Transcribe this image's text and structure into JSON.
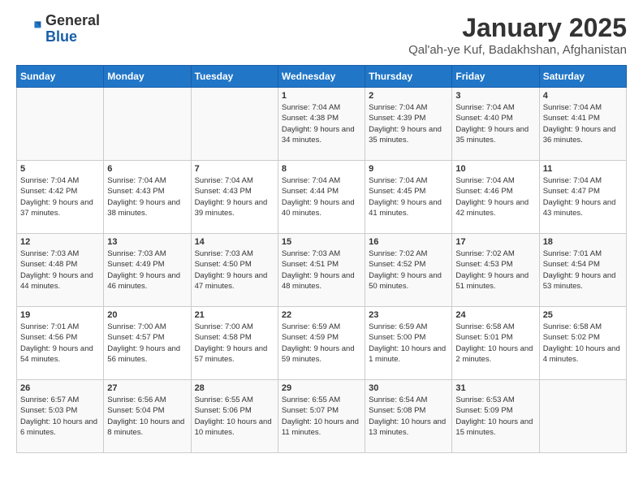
{
  "logo": {
    "general": "General",
    "blue": "Blue"
  },
  "title": "January 2025",
  "subtitle": "Qal'ah-ye Kuf, Badakhshan, Afghanistan",
  "weekdays": [
    "Sunday",
    "Monday",
    "Tuesday",
    "Wednesday",
    "Thursday",
    "Friday",
    "Saturday"
  ],
  "weeks": [
    [
      {
        "day": "",
        "info": ""
      },
      {
        "day": "",
        "info": ""
      },
      {
        "day": "",
        "info": ""
      },
      {
        "day": "1",
        "info": "Sunrise: 7:04 AM\nSunset: 4:38 PM\nDaylight: 9 hours and 34 minutes."
      },
      {
        "day": "2",
        "info": "Sunrise: 7:04 AM\nSunset: 4:39 PM\nDaylight: 9 hours and 35 minutes."
      },
      {
        "day": "3",
        "info": "Sunrise: 7:04 AM\nSunset: 4:40 PM\nDaylight: 9 hours and 35 minutes."
      },
      {
        "day": "4",
        "info": "Sunrise: 7:04 AM\nSunset: 4:41 PM\nDaylight: 9 hours and 36 minutes."
      }
    ],
    [
      {
        "day": "5",
        "info": "Sunrise: 7:04 AM\nSunset: 4:42 PM\nDaylight: 9 hours and 37 minutes."
      },
      {
        "day": "6",
        "info": "Sunrise: 7:04 AM\nSunset: 4:43 PM\nDaylight: 9 hours and 38 minutes."
      },
      {
        "day": "7",
        "info": "Sunrise: 7:04 AM\nSunset: 4:43 PM\nDaylight: 9 hours and 39 minutes."
      },
      {
        "day": "8",
        "info": "Sunrise: 7:04 AM\nSunset: 4:44 PM\nDaylight: 9 hours and 40 minutes."
      },
      {
        "day": "9",
        "info": "Sunrise: 7:04 AM\nSunset: 4:45 PM\nDaylight: 9 hours and 41 minutes."
      },
      {
        "day": "10",
        "info": "Sunrise: 7:04 AM\nSunset: 4:46 PM\nDaylight: 9 hours and 42 minutes."
      },
      {
        "day": "11",
        "info": "Sunrise: 7:04 AM\nSunset: 4:47 PM\nDaylight: 9 hours and 43 minutes."
      }
    ],
    [
      {
        "day": "12",
        "info": "Sunrise: 7:03 AM\nSunset: 4:48 PM\nDaylight: 9 hours and 44 minutes."
      },
      {
        "day": "13",
        "info": "Sunrise: 7:03 AM\nSunset: 4:49 PM\nDaylight: 9 hours and 46 minutes."
      },
      {
        "day": "14",
        "info": "Sunrise: 7:03 AM\nSunset: 4:50 PM\nDaylight: 9 hours and 47 minutes."
      },
      {
        "day": "15",
        "info": "Sunrise: 7:03 AM\nSunset: 4:51 PM\nDaylight: 9 hours and 48 minutes."
      },
      {
        "day": "16",
        "info": "Sunrise: 7:02 AM\nSunset: 4:52 PM\nDaylight: 9 hours and 50 minutes."
      },
      {
        "day": "17",
        "info": "Sunrise: 7:02 AM\nSunset: 4:53 PM\nDaylight: 9 hours and 51 minutes."
      },
      {
        "day": "18",
        "info": "Sunrise: 7:01 AM\nSunset: 4:54 PM\nDaylight: 9 hours and 53 minutes."
      }
    ],
    [
      {
        "day": "19",
        "info": "Sunrise: 7:01 AM\nSunset: 4:56 PM\nDaylight: 9 hours and 54 minutes."
      },
      {
        "day": "20",
        "info": "Sunrise: 7:00 AM\nSunset: 4:57 PM\nDaylight: 9 hours and 56 minutes."
      },
      {
        "day": "21",
        "info": "Sunrise: 7:00 AM\nSunset: 4:58 PM\nDaylight: 9 hours and 57 minutes."
      },
      {
        "day": "22",
        "info": "Sunrise: 6:59 AM\nSunset: 4:59 PM\nDaylight: 9 hours and 59 minutes."
      },
      {
        "day": "23",
        "info": "Sunrise: 6:59 AM\nSunset: 5:00 PM\nDaylight: 10 hours and 1 minute."
      },
      {
        "day": "24",
        "info": "Sunrise: 6:58 AM\nSunset: 5:01 PM\nDaylight: 10 hours and 2 minutes."
      },
      {
        "day": "25",
        "info": "Sunrise: 6:58 AM\nSunset: 5:02 PM\nDaylight: 10 hours and 4 minutes."
      }
    ],
    [
      {
        "day": "26",
        "info": "Sunrise: 6:57 AM\nSunset: 5:03 PM\nDaylight: 10 hours and 6 minutes."
      },
      {
        "day": "27",
        "info": "Sunrise: 6:56 AM\nSunset: 5:04 PM\nDaylight: 10 hours and 8 minutes."
      },
      {
        "day": "28",
        "info": "Sunrise: 6:55 AM\nSunset: 5:06 PM\nDaylight: 10 hours and 10 minutes."
      },
      {
        "day": "29",
        "info": "Sunrise: 6:55 AM\nSunset: 5:07 PM\nDaylight: 10 hours and 11 minutes."
      },
      {
        "day": "30",
        "info": "Sunrise: 6:54 AM\nSunset: 5:08 PM\nDaylight: 10 hours and 13 minutes."
      },
      {
        "day": "31",
        "info": "Sunrise: 6:53 AM\nSunset: 5:09 PM\nDaylight: 10 hours and 15 minutes."
      },
      {
        "day": "",
        "info": ""
      }
    ]
  ]
}
